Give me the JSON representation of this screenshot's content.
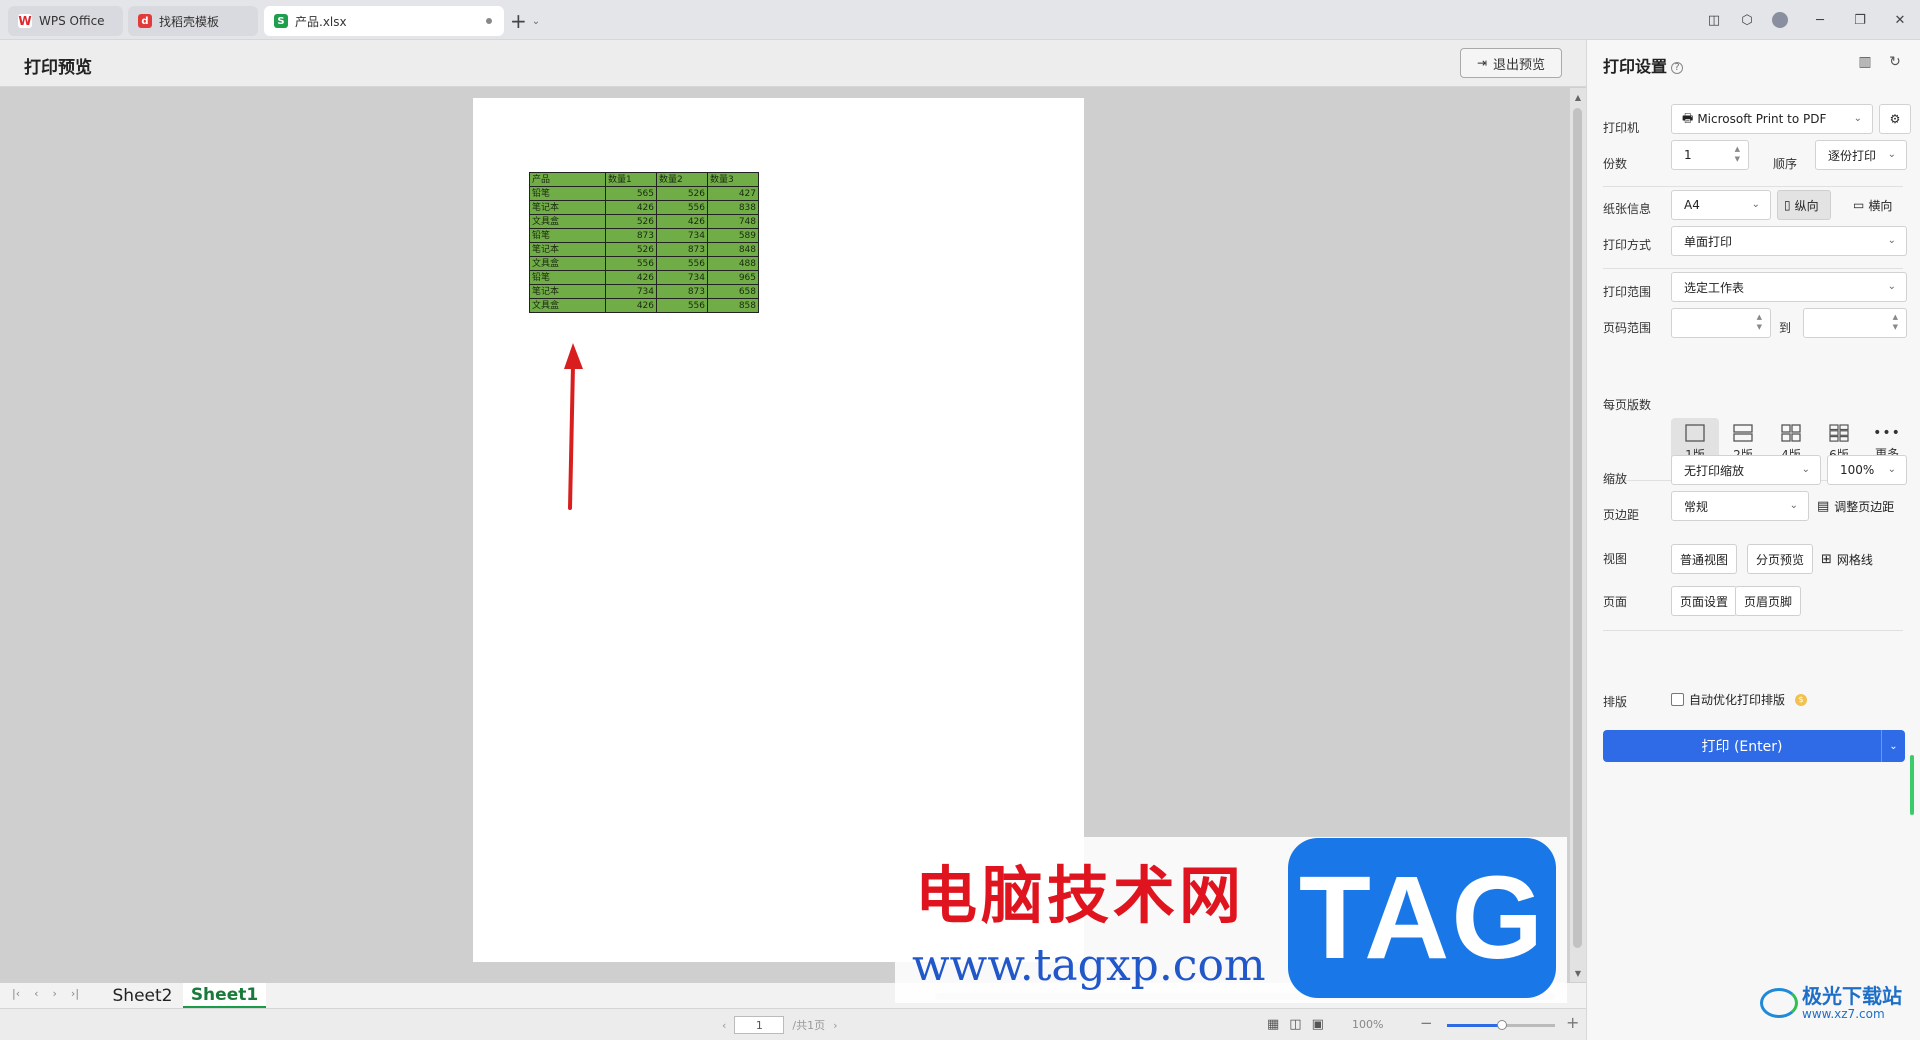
{
  "tabs": [
    {
      "label": "WPS Office",
      "icon": "wps-logo-icon"
    },
    {
      "label": "找稻壳模板",
      "icon": "docer-logo-icon"
    },
    {
      "label": "产品.xlsx",
      "icon": "spreadsheet-s-icon"
    }
  ],
  "header": {
    "title": "打印预览",
    "exit_label": "退出预览"
  },
  "sheet_table": {
    "columns": [
      "产品",
      "数量1",
      "数量2",
      "数量3"
    ],
    "rows": [
      [
        "铅笔",
        "565",
        "526",
        "427"
      ],
      [
        "笔记本",
        "426",
        "556",
        "838"
      ],
      [
        "文具盒",
        "526",
        "426",
        "748"
      ],
      [
        "铅笔",
        "873",
        "734",
        "589"
      ],
      [
        "笔记本",
        "526",
        "873",
        "848"
      ],
      [
        "文具盒",
        "556",
        "556",
        "488"
      ],
      [
        "铅笔",
        "426",
        "734",
        "965"
      ],
      [
        "笔记本",
        "734",
        "873",
        "658"
      ],
      [
        "文具盒",
        "426",
        "556",
        "858"
      ]
    ],
    "fill_color": "#70ad47"
  },
  "sheets": [
    "Sheet2",
    "Sheet1"
  ],
  "active_sheet": "Sheet1",
  "status": {
    "page_value": "1",
    "page_total": "/共1页",
    "zoom": "100%"
  },
  "panel": {
    "title": "打印设置",
    "printer_label": "打印机",
    "printer_value": "Microsoft Print to PDF",
    "copies_label": "份数",
    "copies_value": "1",
    "order_label": "顺序",
    "order_value": "逐份打印",
    "paper_label": "纸张信息",
    "paper_value": "A4",
    "portrait_label": "纵向",
    "landscape_label": "横向",
    "mode_label": "打印方式",
    "mode_value": "单面打印",
    "range_label": "打印范围",
    "range_value": "选定工作表",
    "pages_label": "页码范围",
    "pages_to": "到",
    "per_page_label": "每页版数",
    "layouts": [
      "1版",
      "2版",
      "4版",
      "6版",
      "更多"
    ],
    "scale_label": "缩放",
    "scale_value": "无打印缩放",
    "scale_pct": "100%",
    "margin_label": "页边距",
    "margin_value": "常规",
    "adjust_margin": "调整页边距",
    "view_label": "视图",
    "normal_view": "普通视图",
    "page_break": "分页预览",
    "gridlines": "网格线",
    "page_label": "页面",
    "page_setup": "页面设置",
    "header_footer": "页眉页脚",
    "layout_label": "排版",
    "auto_optimize": "自动优化打印排版",
    "print_label": "打印 (Enter)",
    "accent_color": "#2f6be6"
  },
  "watermark": {
    "cn": "电脑技术网",
    "url": "www.tagxp.com",
    "tag": "TAG",
    "site2_name": "极光下载站",
    "site2_url": "www.xz7.com"
  }
}
